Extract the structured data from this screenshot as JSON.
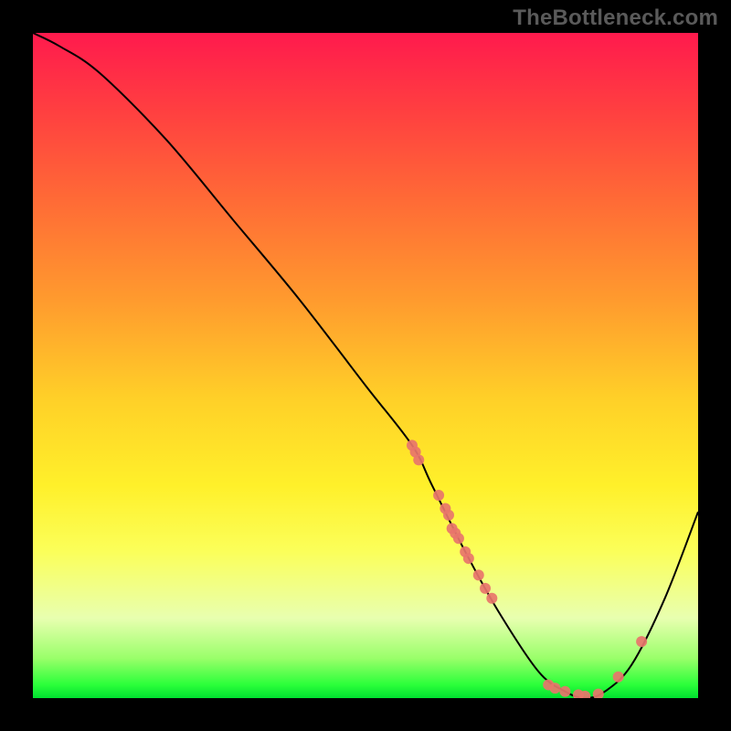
{
  "watermark": "TheBottleneck.com",
  "chart_data": {
    "type": "line",
    "title": "",
    "xlabel": "",
    "ylabel": "",
    "xlim": [
      0,
      100
    ],
    "ylim": [
      0,
      100
    ],
    "grid": false,
    "legend": false,
    "series": [
      {
        "name": "bottleneck-curve",
        "x": [
          0,
          4,
          10,
          20,
          30,
          40,
          50,
          57,
          60,
          65,
          70,
          76,
          80,
          83,
          86,
          90,
          95,
          100
        ],
        "y": [
          100,
          98,
          94,
          84,
          72,
          60,
          47,
          38,
          32,
          22,
          13,
          4,
          1,
          0,
          1,
          5,
          15,
          28
        ],
        "color": "#000000",
        "width": 2
      }
    ],
    "markers": [
      {
        "name": "datapoints",
        "color": "#e8756b",
        "radius": 6,
        "points": [
          {
            "x": 57.0,
            "y": 38.0
          },
          {
            "x": 57.5,
            "y": 37.0
          },
          {
            "x": 58.0,
            "y": 35.8
          },
          {
            "x": 61.0,
            "y": 30.5
          },
          {
            "x": 62.0,
            "y": 28.5
          },
          {
            "x": 62.5,
            "y": 27.5
          },
          {
            "x": 63.0,
            "y": 25.5
          },
          {
            "x": 63.5,
            "y": 24.8
          },
          {
            "x": 64.0,
            "y": 24.0
          },
          {
            "x": 65.0,
            "y": 22.0
          },
          {
            "x": 65.5,
            "y": 21.0
          },
          {
            "x": 67.0,
            "y": 18.5
          },
          {
            "x": 68.0,
            "y": 16.5
          },
          {
            "x": 69.0,
            "y": 15.0
          },
          {
            "x": 77.5,
            "y": 2.0
          },
          {
            "x": 78.5,
            "y": 1.5
          },
          {
            "x": 80.0,
            "y": 1.0
          },
          {
            "x": 82.0,
            "y": 0.5
          },
          {
            "x": 83.0,
            "y": 0.3
          },
          {
            "x": 85.0,
            "y": 0.6
          },
          {
            "x": 88.0,
            "y": 3.2
          },
          {
            "x": 91.5,
            "y": 8.5
          }
        ]
      }
    ]
  }
}
